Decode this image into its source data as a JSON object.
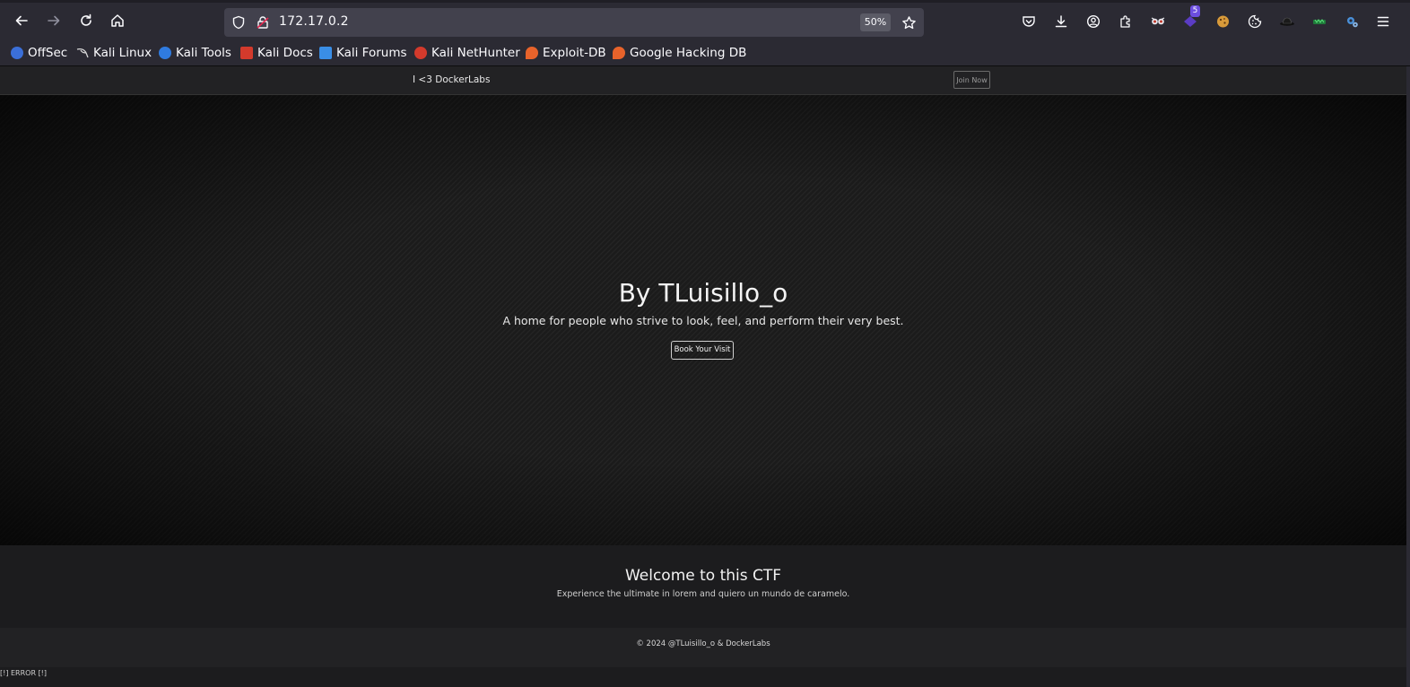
{
  "browser": {
    "url": "172.17.0.2",
    "zoom": "50%",
    "extension_badge": "5"
  },
  "bookmarks": [
    {
      "label": "OffSec",
      "icon": "offsec-icon",
      "color": "#3b6fd8"
    },
    {
      "label": "Kali Linux",
      "icon": "kali-dragon-icon",
      "color": "#cccccc"
    },
    {
      "label": "Kali Tools",
      "icon": "kali-tools-icon",
      "color": "#2f7be0"
    },
    {
      "label": "Kali Docs",
      "icon": "kali-docs-icon",
      "color": "#d33a2c"
    },
    {
      "label": "Kali Forums",
      "icon": "kali-forums-icon",
      "color": "#3a8ee6"
    },
    {
      "label": "Kali NetHunter",
      "icon": "nethunter-icon",
      "color": "#d33a2c"
    },
    {
      "label": "Exploit-DB",
      "icon": "exploit-db-icon",
      "color": "#e8632b"
    },
    {
      "label": "Google Hacking DB",
      "icon": "ghdb-icon",
      "color": "#e8632b"
    }
  ],
  "site": {
    "brand": "I <3 DockerLabs",
    "join_label": "Join Now",
    "hero": {
      "title": "By TLuisillo_o",
      "subtitle": "A home for people who strive to look, feel, and perform their very best.",
      "button": "Book Your Visit"
    },
    "welcome": {
      "title": "Welcome to this CTF",
      "subtitle": "Experience the ultimate in lorem and quiero un mundo de caramelo."
    },
    "footer": "© 2024 @TLuisillo_o & DockerLabs",
    "error": "[!] ERROR [!]"
  }
}
